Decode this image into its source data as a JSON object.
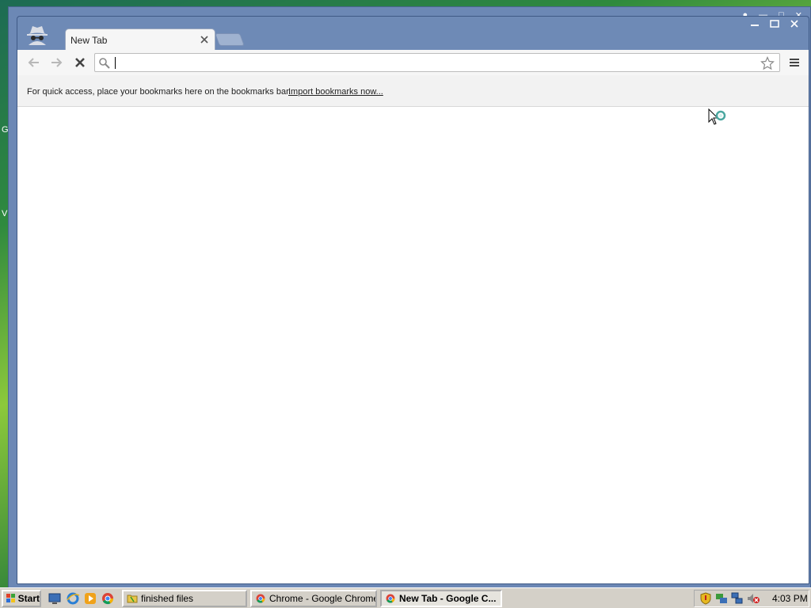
{
  "desktop": {
    "side_labels": [
      "G",
      "V"
    ]
  },
  "browser": {
    "tab": {
      "title": "New Tab",
      "close_icon": "close-icon"
    },
    "new_tab_icon": "new-tab-icon",
    "incognito_icon": "incognito-icon",
    "window_controls": [
      "minimize-icon",
      "maximize-icon",
      "close-icon"
    ],
    "toolbar": {
      "back_icon": "back-arrow-icon",
      "forward_icon": "forward-arrow-icon",
      "stop_icon": "stop-x-icon",
      "omnibox_value": "",
      "star_icon": "bookmark-star-icon",
      "menu_icon": "hamburger-menu-icon"
    },
    "bookmarks_bar": {
      "text": "For quick access, place your bookmarks here on the bookmarks bar.",
      "import_link": "Import bookmarks now..."
    }
  },
  "taskbar": {
    "start_label": "Start",
    "quick_launch": [
      "show-desktop-icon",
      "internet-explorer-icon",
      "media-player-icon",
      "chrome-icon"
    ],
    "tasks": [
      {
        "label": "finished files",
        "icon": "folder-icon",
        "active": false
      },
      {
        "label": "Chrome - Google Chrome",
        "icon": "chrome-icon",
        "active": false
      },
      {
        "label": "New Tab - Google C...",
        "icon": "chrome-icon",
        "active": true
      }
    ],
    "tray_icons": [
      "security-shield-icon",
      "network-icon",
      "network-connection-icon",
      "volume-muted-icon"
    ],
    "clock": "4:03 PM"
  },
  "colors": {
    "frame": "#6e8ab6",
    "toolbar": "#f6f6f6",
    "taskbar": "#d4d0c8"
  }
}
